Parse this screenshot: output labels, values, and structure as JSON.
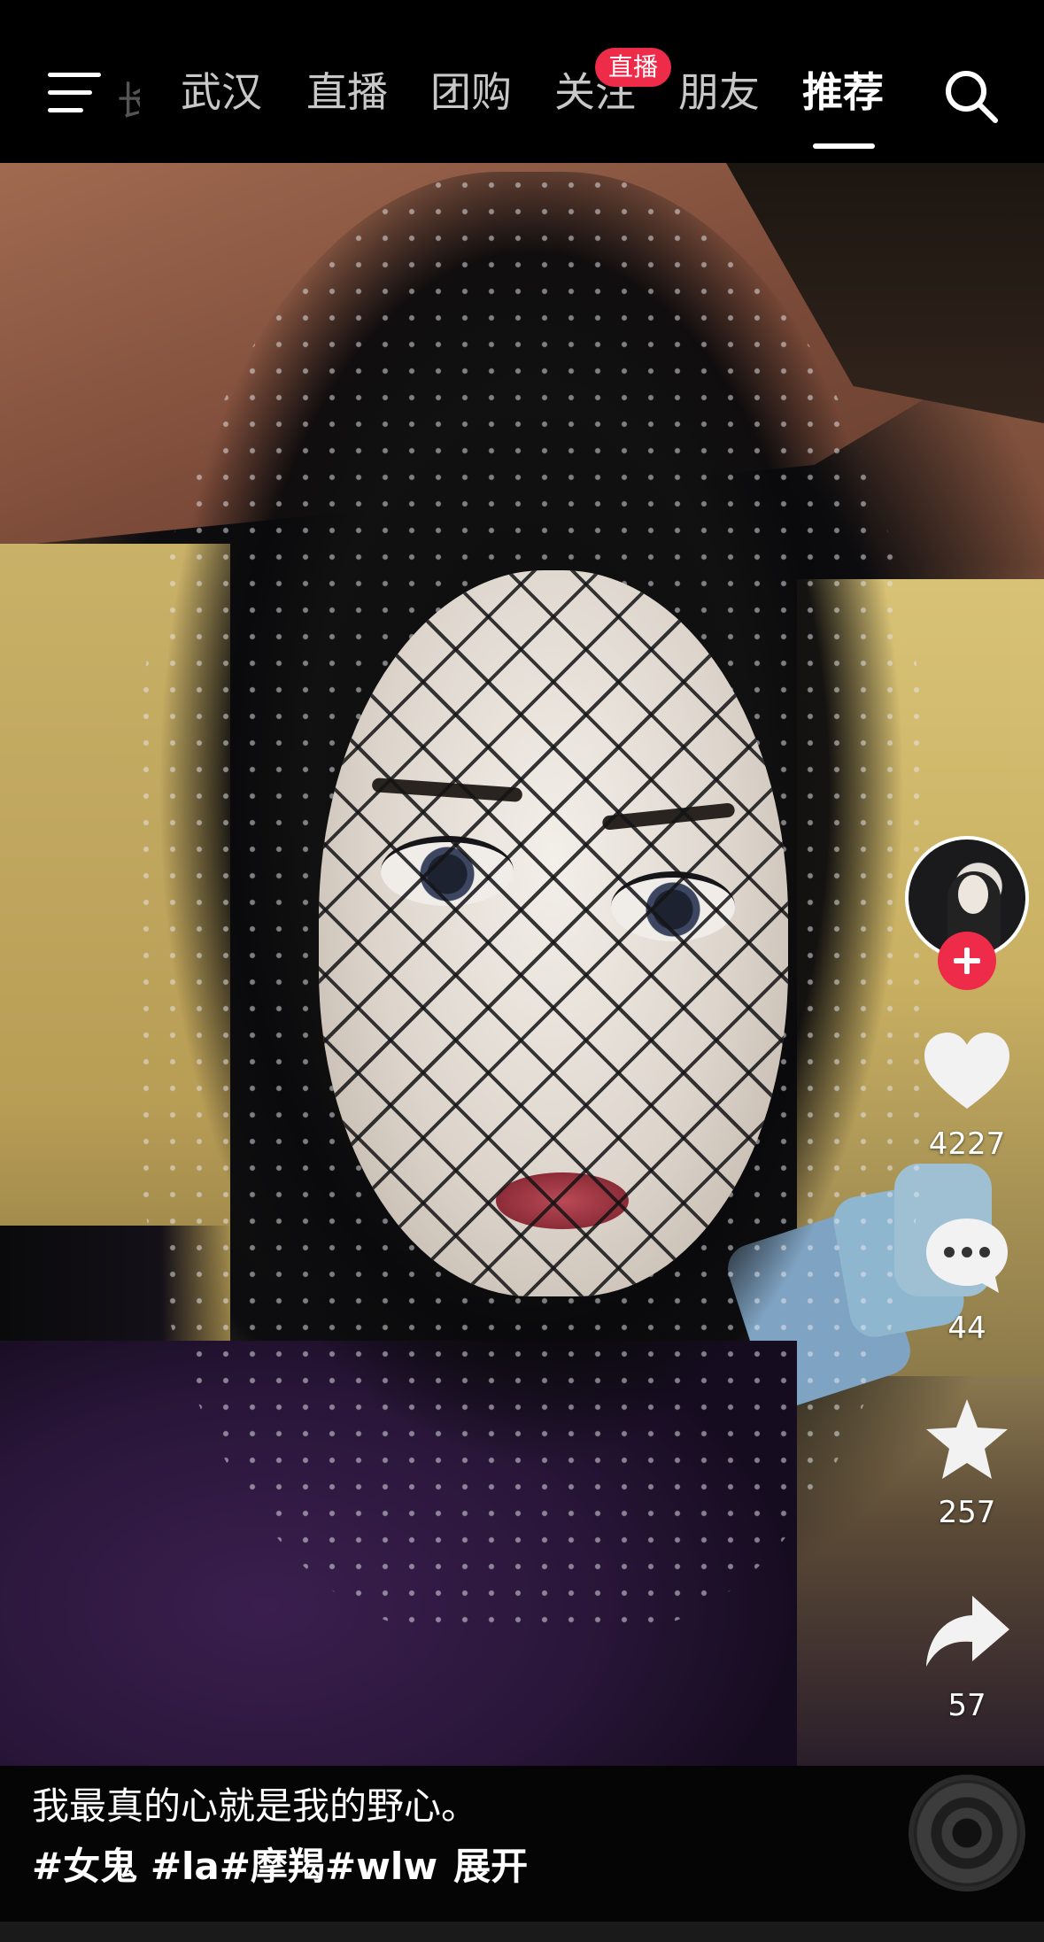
{
  "nav": {
    "faded_tab": "长",
    "tabs": [
      {
        "label": "武汉",
        "active": false
      },
      {
        "label": "直播",
        "active": false
      },
      {
        "label": "团购",
        "active": false
      },
      {
        "label": "关注",
        "active": false
      },
      {
        "label": "朋友",
        "active": false
      },
      {
        "label": "推荐",
        "active": true
      }
    ],
    "live_badge": "直播",
    "menu_icon": "menu-icon",
    "search_icon": "search-icon"
  },
  "rail": {
    "likes": "4227",
    "comments": "44",
    "favorites": "257",
    "shares": "57"
  },
  "caption": {
    "line1": "我最真的心就是我的野心。",
    "hashtags": "#女鬼 #la#摩羯#wlw",
    "expand": "展开"
  },
  "colors": {
    "accent": "#ee2c4a",
    "background": "#000000"
  }
}
